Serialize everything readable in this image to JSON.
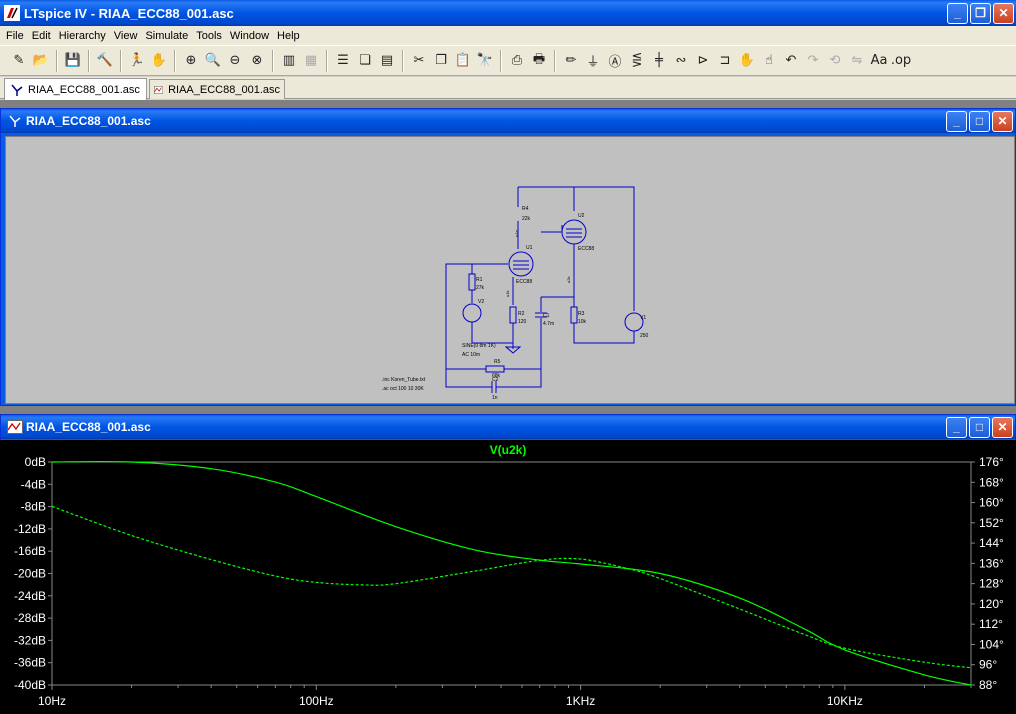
{
  "window": {
    "title": "LTspice IV - RIAA_ECC88_001.asc",
    "min_label": "_",
    "max_label": "❐",
    "close_label": "✕"
  },
  "menu": [
    "File",
    "Edit",
    "Hierarchy",
    "View",
    "Simulate",
    "Tools",
    "Window",
    "Help"
  ],
  "toolbar": [
    "new-schematic-icon",
    "open-icon",
    "|",
    "save-icon",
    "|",
    "control-panel-icon",
    "|",
    "run-icon",
    "pan-icon",
    "|",
    "zoom-in-icon",
    "zoom-area-icon",
    "zoom-out-icon",
    "zoom-fit-icon",
    "|",
    "autorange-icon",
    "grid-icon",
    "|",
    "tile-horizontal-icon",
    "cascade-icon",
    "tile-vertical-icon",
    "|",
    "cut-icon",
    "copy-icon",
    "paste-icon",
    "find-icon",
    "|",
    "print-setup-icon",
    "print-icon",
    "|",
    "draw-wire-icon",
    "ground-icon",
    "label-icon",
    "resistor-icon",
    "capacitor-icon",
    "inductor-icon",
    "diode-icon",
    "component-icon",
    "move-icon",
    "drag-icon",
    "undo-icon",
    "redo-icon",
    "rotate-icon",
    "mirror-icon",
    "text-icon",
    "spice-directive-icon"
  ],
  "tabs": [
    {
      "label": "RIAA_ECC88_001.asc",
      "kind": "schematic",
      "active": true
    },
    {
      "label": "RIAA_ECC88_001.asc",
      "kind": "waveform",
      "active": false
    }
  ],
  "schematic_window": {
    "title": "RIAA_ECC88_001.asc",
    "labels": {
      "r4": "R4",
      "r4v": "22k",
      "u1": "U1",
      "u1t": "ECC88",
      "u2": "U2",
      "u2t": "ECC88",
      "r1": "R1",
      "r1v": "27k",
      "r2": "R2",
      "r2v": "120",
      "r3": "R3",
      "r3v": "10k",
      "c1": "C1",
      "c1v": "4.7m",
      "v1": "V1",
      "v1v": "250",
      "v2": "V2",
      "r5": "R5",
      "r5v": "68k",
      "c2": "C2",
      "c2v": "1n",
      "net1": "u1a",
      "net2": "u1k",
      "net3": "u2k",
      "src1": "SINE(0 8m 1K)",
      "src2": "AC 10m",
      "dir1": ".inc Koren_Tube.txt",
      "dir2": ".ac oct 100 10 30K"
    }
  },
  "wave_window": {
    "title": "RIAA_ECC88_001.asc",
    "trace_name": "V(u2k)",
    "trace_color": "#00ff00"
  },
  "chart_data": {
    "type": "line",
    "title": "V(u2k)",
    "x_scale": "log",
    "xlim": [
      10,
      30000
    ],
    "x_ticks": [
      "10Hz",
      "100Hz",
      "1KHz",
      "10KHz"
    ],
    "y_left_ticks": [
      "0dB",
      "-4dB",
      "-8dB",
      "-12dB",
      "-16dB",
      "-20dB",
      "-24dB",
      "-28dB",
      "-32dB",
      "-36dB",
      "-40dB"
    ],
    "y_left_range": [
      -40,
      0
    ],
    "y_right_ticks": [
      "176°",
      "168°",
      "160°",
      "152°",
      "144°",
      "136°",
      "128°",
      "120°",
      "112°",
      "104°",
      "96°",
      "88°"
    ],
    "y_right_range": [
      88,
      176
    ],
    "grid": false,
    "series": [
      {
        "name": "magnitude",
        "style": "solid",
        "x": [
          10,
          20,
          40,
          70,
          100,
          200,
          400,
          700,
          1000,
          2000,
          4000,
          7000,
          10000,
          20000,
          30000
        ],
        "y": [
          0,
          0,
          -1.2,
          -3.6,
          -6.2,
          -11.6,
          -15.8,
          -17.6,
          -18.3,
          -20.0,
          -24.4,
          -29.9,
          -33.7,
          -38.2,
          -40.0
        ]
      },
      {
        "name": "phase",
        "style": "dashed",
        "x": [
          10,
          20,
          40,
          70,
          100,
          150,
          200,
          400,
          700,
          1000,
          1500,
          2000,
          4000,
          7000,
          10000,
          20000,
          30000
        ],
        "y": [
          158.5,
          147,
          137.5,
          131,
          128.5,
          127.5,
          128,
          133,
          137.2,
          137.7,
          134,
          130,
          118,
          108,
          102.5,
          97,
          94.8
        ]
      }
    ]
  }
}
